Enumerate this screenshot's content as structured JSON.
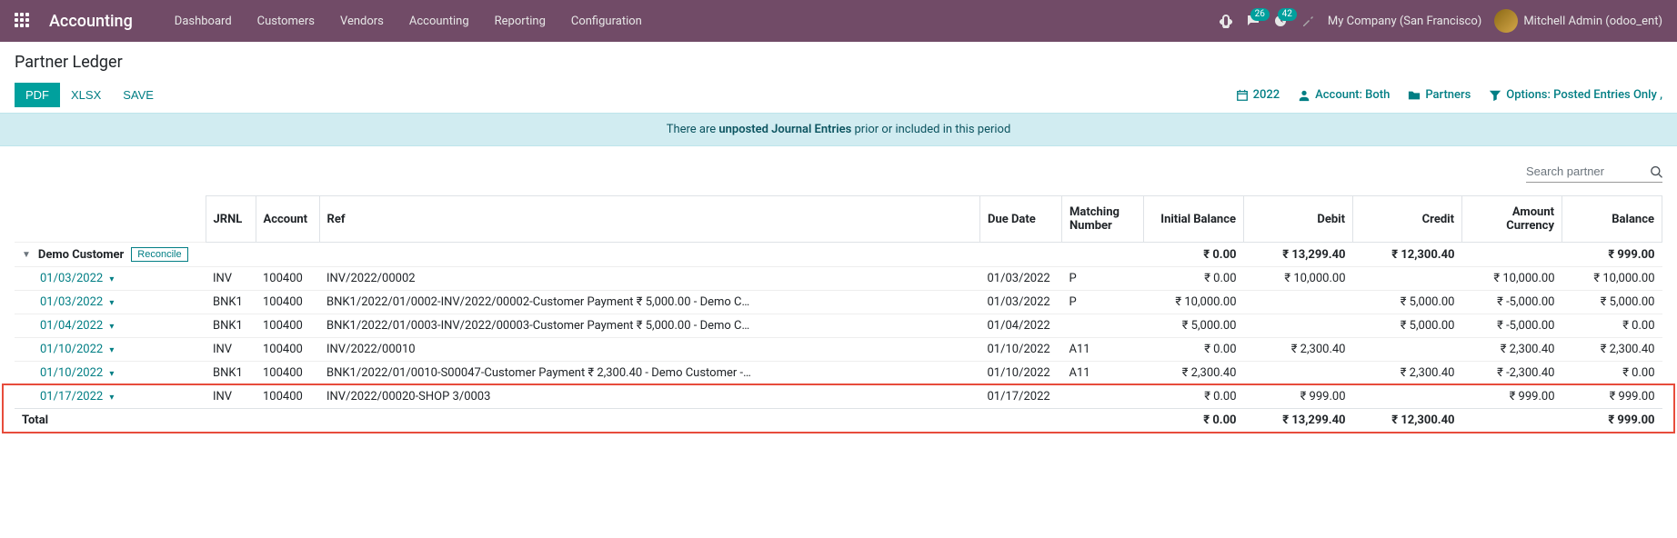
{
  "navbar": {
    "brand": "Accounting",
    "menu": [
      "Dashboard",
      "Customers",
      "Vendors",
      "Accounting",
      "Reporting",
      "Configuration"
    ],
    "messages_badge": "26",
    "activities_badge": "42",
    "company": "My Company (San Francisco)",
    "user": "Mitchell Admin (odoo_ent)"
  },
  "control_panel": {
    "title": "Partner Ledger",
    "buttons": {
      "pdf": "PDF",
      "xlsx": "XLSX",
      "save": "SAVE"
    },
    "filters": {
      "year": "2022",
      "account": "Account: Both",
      "partners": "Partners",
      "options": "Options: Posted Entries Only ,"
    }
  },
  "alert": {
    "pre": "There are ",
    "strong": "unposted Journal Entries",
    "post": " prior or included in this period"
  },
  "search": {
    "placeholder": "Search partner"
  },
  "table": {
    "headers": {
      "jrnl": "JRNL",
      "account": "Account",
      "ref": "Ref",
      "due_date": "Due Date",
      "matching": "Matching Number",
      "initial": "Initial Balance",
      "debit": "Debit",
      "credit": "Credit",
      "amount_currency": "Amount Currency",
      "balance": "Balance"
    },
    "partner": {
      "name": "Demo Customer",
      "reconcile": "Reconcile",
      "initial": "₹ 0.00",
      "debit": "₹ 13,299.40",
      "credit": "₹ 12,300.40",
      "balance": "₹ 999.00"
    },
    "rows": [
      {
        "date": "01/03/2022",
        "jrnl": "INV",
        "account": "100400",
        "ref": "INV/2022/00002",
        "due": "01/03/2022",
        "match": "P",
        "initial": "₹ 0.00",
        "debit": "₹ 10,000.00",
        "credit": "",
        "amt_cur": "₹ 10,000.00",
        "balance": "₹ 10,000.00"
      },
      {
        "date": "01/03/2022",
        "jrnl": "BNK1",
        "account": "100400",
        "ref": "BNK1/2022/01/0002-INV/2022/00002-Customer Payment ₹ 5,000.00 - Demo C…",
        "due": "01/03/2022",
        "match": "P",
        "initial": "₹ 10,000.00",
        "debit": "",
        "credit": "₹ 5,000.00",
        "amt_cur": "₹ -5,000.00",
        "balance": "₹ 5,000.00"
      },
      {
        "date": "01/04/2022",
        "jrnl": "BNK1",
        "account": "100400",
        "ref": "BNK1/2022/01/0003-INV/2022/00003-Customer Payment ₹ 5,000.00 - Demo C…",
        "due": "01/04/2022",
        "match": "",
        "initial": "₹ 5,000.00",
        "debit": "",
        "credit": "₹ 5,000.00",
        "amt_cur": "₹ -5,000.00",
        "balance": "₹ 0.00"
      },
      {
        "date": "01/10/2022",
        "jrnl": "INV",
        "account": "100400",
        "ref": "INV/2022/00010",
        "due": "01/10/2022",
        "match": "A11",
        "initial": "₹ 0.00",
        "debit": "₹ 2,300.40",
        "credit": "",
        "amt_cur": "₹ 2,300.40",
        "balance": "₹ 2,300.40"
      },
      {
        "date": "01/10/2022",
        "jrnl": "BNK1",
        "account": "100400",
        "ref": "BNK1/2022/01/0010-S00047-Customer Payment ₹ 2,300.40 - Demo Customer -…",
        "due": "01/10/2022",
        "match": "A11",
        "initial": "₹ 2,300.40",
        "debit": "",
        "credit": "₹ 2,300.40",
        "amt_cur": "₹ -2,300.40",
        "balance": "₹ 0.00"
      },
      {
        "date": "01/17/2022",
        "jrnl": "INV",
        "account": "100400",
        "ref": "INV/2022/00020-SHOP 3/0003",
        "due": "01/17/2022",
        "match": "",
        "initial": "₹ 0.00",
        "debit": "₹ 999.00",
        "credit": "",
        "amt_cur": "₹ 999.00",
        "balance": "₹ 999.00"
      }
    ],
    "total": {
      "label": "Total",
      "initial": "₹ 0.00",
      "debit": "₹ 13,299.40",
      "credit": "₹ 12,300.40",
      "balance": "₹ 999.00"
    }
  }
}
